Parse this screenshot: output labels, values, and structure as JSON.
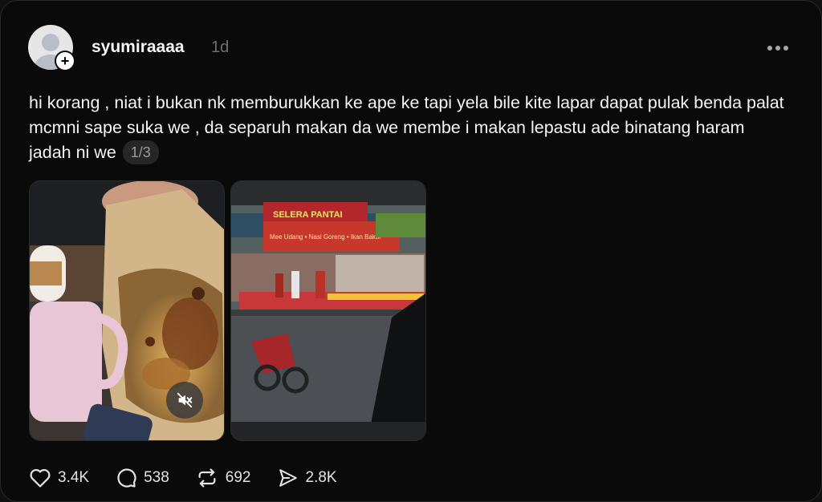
{
  "post": {
    "username": "syumiraaaa",
    "timestamp": "1d",
    "text": "hi korang , niat i bukan nk memburukkan ke ape ke tapi yela bile kite lapar dapat pulak benda palat mcmni sape suka we , da separuh makan da we membe i makan lepastu ade binatang haram jadah ni we",
    "media_counter": "1/3",
    "follow_symbol": "+"
  },
  "media": [
    {
      "kind": "video",
      "description_icon": "muted-speaker-icon"
    },
    {
      "kind": "image"
    }
  ],
  "actions": {
    "likes": "3.4K",
    "replies": "538",
    "reposts": "692",
    "shares": "2.8K"
  },
  "store_sign": {
    "line1": "SELERA PANTAI",
    "line2": "Mee Udang • Nasi Goreng • Ikan Bakar"
  },
  "colors": {
    "background": "#0a0a0a",
    "text": "#f3f5f7",
    "muted": "#6f6f6f",
    "pill": "#262626"
  }
}
